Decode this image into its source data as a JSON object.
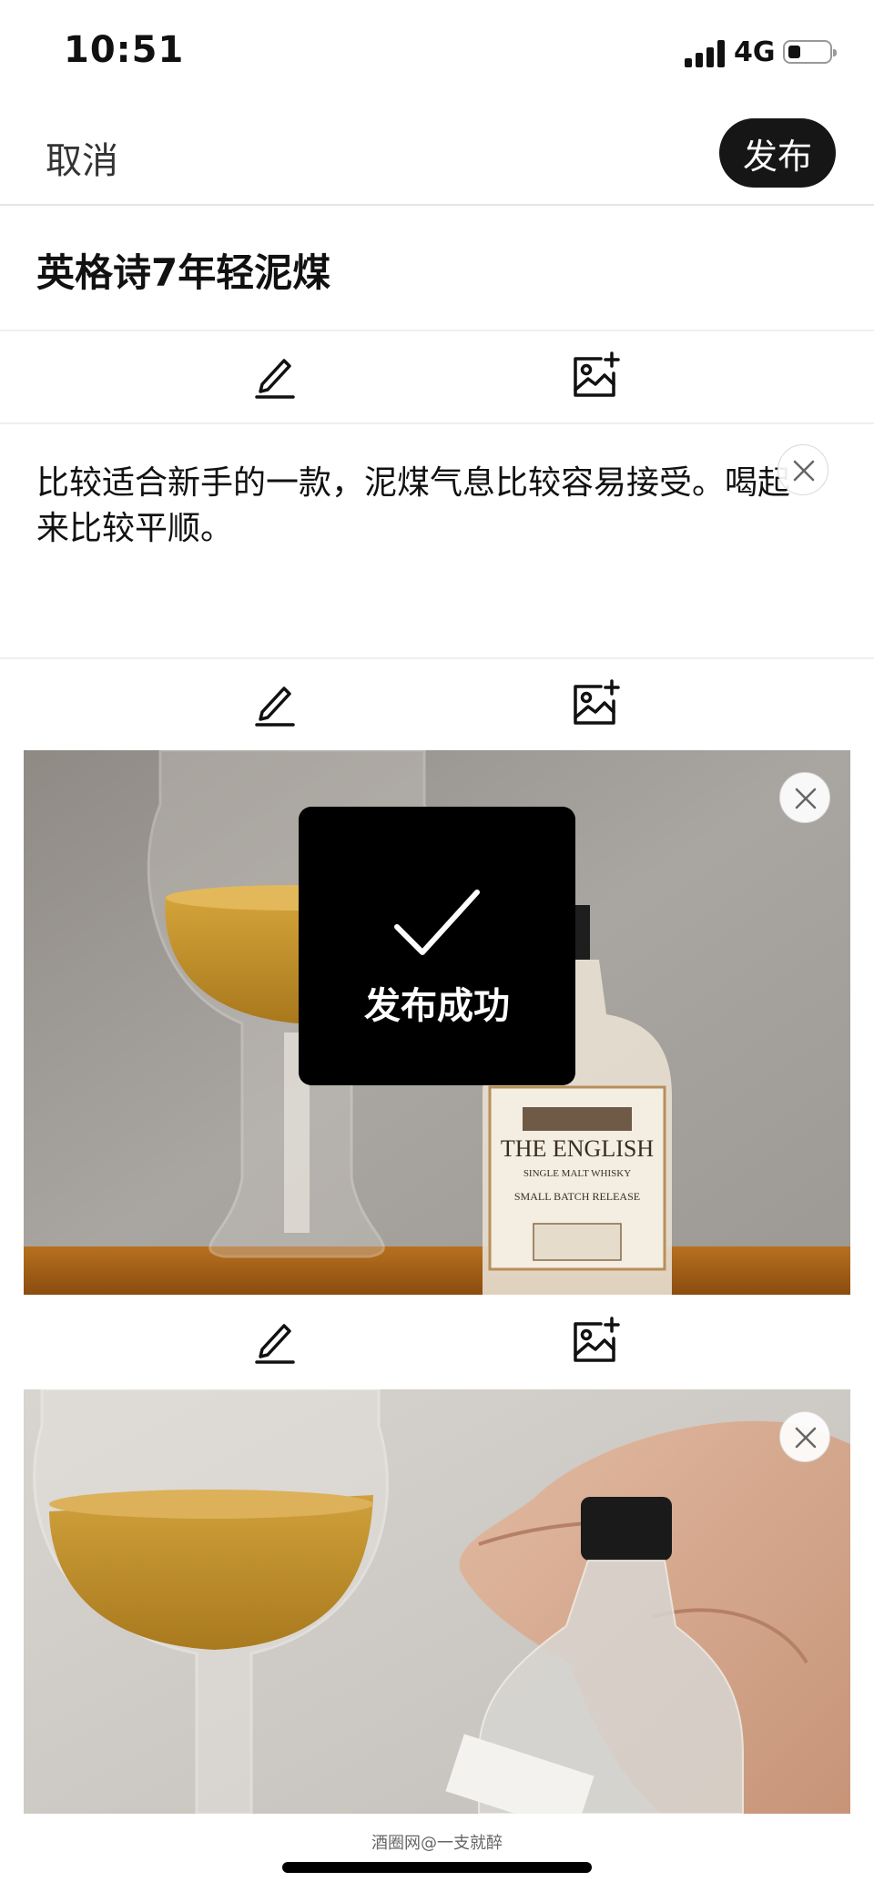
{
  "status_bar": {
    "time": "10:51",
    "network": "4G",
    "battery_level": 0.3,
    "signal_bars": 4
  },
  "top_bar": {
    "cancel_label": "取消",
    "publish_label": "发布"
  },
  "post": {
    "title": "英格诗7年轻泥煤",
    "body_text": "比较适合新手的一款，泥煤气息比较容易接受。喝起来比较平顺。",
    "photos": [
      {
        "bottle_label_line1": "THE ENGLISH",
        "bottle_label_line2": "SINGLE MALT WHISKY",
        "bottle_label_line3": "SMALL BATCH RELEASE"
      },
      {}
    ]
  },
  "toast": {
    "message": "发布成功"
  },
  "watermark": "酒圈网@一支就醉",
  "colors": {
    "publish_button_bg": "#161616",
    "toast_bg": "#000000",
    "divider": "#efefef"
  },
  "icons": {
    "edit": "pencil-icon",
    "add_image": "image-add-icon",
    "close": "close-icon",
    "check": "check-icon"
  }
}
